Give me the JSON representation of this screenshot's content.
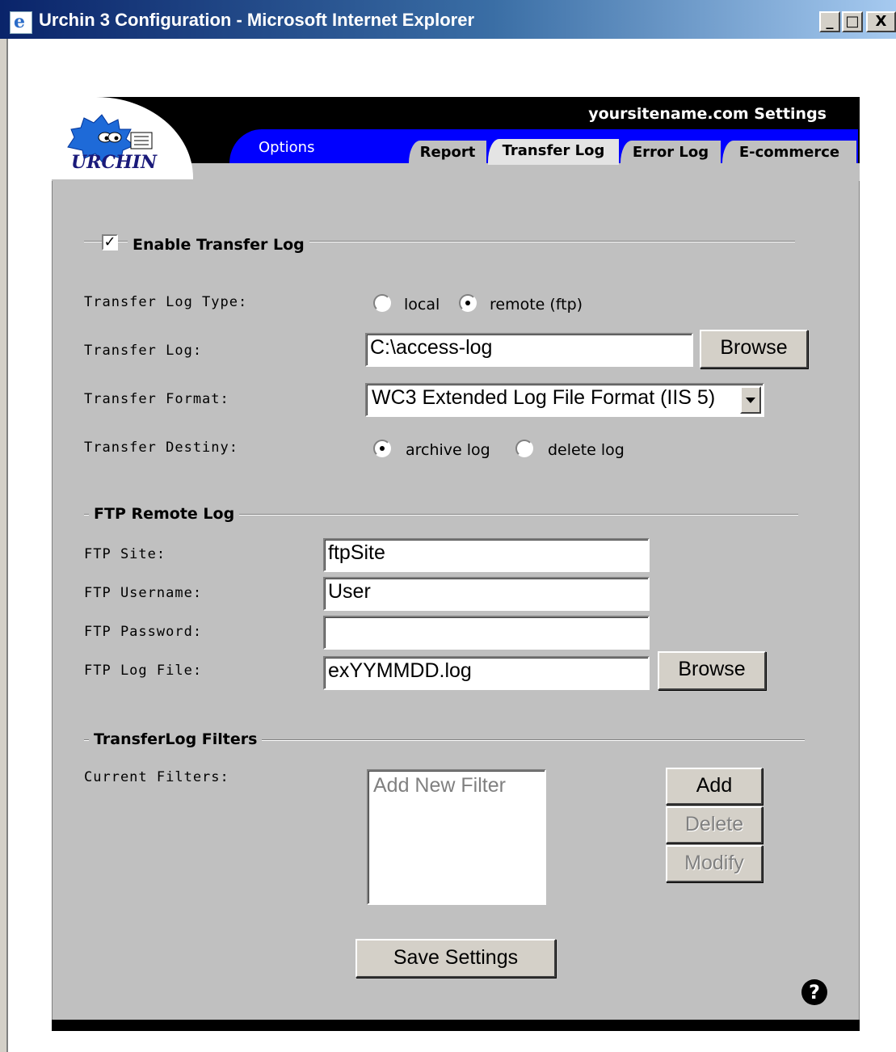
{
  "window": {
    "title": "Urchin 3 Configuration - Microsoft Internet Explorer",
    "controls": {
      "minimize": "_",
      "maximize": "□",
      "close": "X"
    }
  },
  "header": {
    "logo_text": "URCHIN",
    "site_settings": "yoursitename.com Settings",
    "options_label": "Options",
    "tabs": [
      {
        "label": "Report",
        "active": false
      },
      {
        "label": "Transfer Log",
        "active": true
      },
      {
        "label": "Error Log",
        "active": false
      },
      {
        "label": "E-commerce",
        "active": false
      }
    ]
  },
  "transfer_log": {
    "enable_label": "Enable Transfer Log",
    "enabled": true,
    "type_label": "Transfer Log Type:",
    "type_options": [
      "local",
      "remote (ftp)"
    ],
    "type_selected": "remote (ftp)",
    "log_label": "Transfer Log:",
    "log_value": "C:\\access-log",
    "browse_label": "Browse",
    "format_label": "Transfer Format:",
    "format_value": "WC3 Extended Log File Format (IIS 5)",
    "destiny_label": "Transfer Destiny:",
    "destiny_options": [
      "archive log",
      "delete log"
    ],
    "destiny_selected": "archive log"
  },
  "ftp": {
    "section_title": "FTP Remote Log",
    "site_label": "FTP Site:",
    "site_value": "ftpSite",
    "username_label": "FTP Username:",
    "username_value": "User",
    "password_label": "FTP Password:",
    "password_value": "",
    "logfile_label": "FTP Log File:",
    "logfile_value": "exYYMMDD.log",
    "browse_label": "Browse"
  },
  "filters": {
    "section_title": "TransferLog Filters",
    "current_label": "Current Filters:",
    "list_items": [
      "Add New Filter"
    ],
    "add_label": "Add",
    "delete_label": "Delete",
    "modify_label": "Modify"
  },
  "footer": {
    "save_label": "Save Settings",
    "help_glyph": "?"
  },
  "colors": {
    "title_bar": "#0a246a",
    "tab_band": "#0000ff",
    "panel": "#c0c0c0"
  }
}
